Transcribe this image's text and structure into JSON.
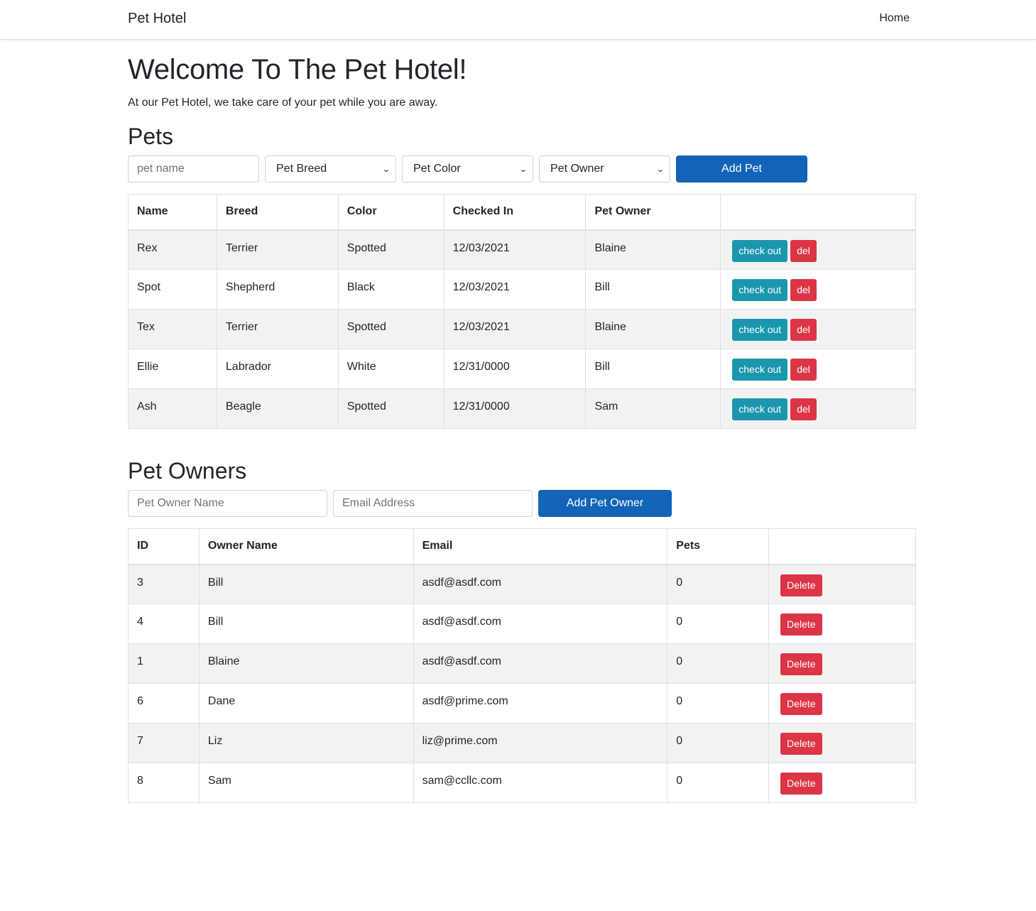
{
  "navbar": {
    "brand": "Pet Hotel",
    "home_link": "Home"
  },
  "header": {
    "title": "Welcome To The Pet Hotel!",
    "subtitle": "At our Pet Hotel, we take care of your pet while you are away."
  },
  "pets": {
    "heading": "Pets",
    "form": {
      "name_placeholder": "pet name",
      "breed_select": "Pet Breed",
      "color_select": "Pet Color",
      "owner_select": "Pet Owner",
      "add_button": "Add Pet"
    },
    "columns": [
      "Name",
      "Breed",
      "Color",
      "Checked In",
      "Pet Owner",
      ""
    ],
    "rows": [
      {
        "name": "Rex",
        "breed": "Terrier",
        "color": "Spotted",
        "checked_in": "12/03/2021",
        "owner": "Blaine"
      },
      {
        "name": "Spot",
        "breed": "Shepherd",
        "color": "Black",
        "checked_in": "12/03/2021",
        "owner": "Bill"
      },
      {
        "name": "Tex",
        "breed": "Terrier",
        "color": "Spotted",
        "checked_in": "12/03/2021",
        "owner": "Blaine"
      },
      {
        "name": "Ellie",
        "breed": "Labrador",
        "color": "White",
        "checked_in": "12/31/0000",
        "owner": "Bill"
      },
      {
        "name": "Ash",
        "breed": "Beagle",
        "color": "Spotted",
        "checked_in": "12/31/0000",
        "owner": "Sam"
      }
    ],
    "checkout_label": "check out",
    "delete_label": "del"
  },
  "owners": {
    "heading": "Pet Owners",
    "form": {
      "name_placeholder": "Pet Owner Name",
      "email_placeholder": "Email Address",
      "add_button": "Add Pet Owner"
    },
    "columns": [
      "ID",
      "Owner Name",
      "Email",
      "Pets",
      ""
    ],
    "rows": [
      {
        "id": "3",
        "name": "Bill",
        "email": "asdf@asdf.com",
        "pets": "0"
      },
      {
        "id": "4",
        "name": "Bill",
        "email": "asdf@asdf.com",
        "pets": "0"
      },
      {
        "id": "1",
        "name": "Blaine",
        "email": "asdf@asdf.com",
        "pets": "0"
      },
      {
        "id": "6",
        "name": "Dane",
        "email": "asdf@prime.com",
        "pets": "0"
      },
      {
        "id": "7",
        "name": "Liz",
        "email": "liz@prime.com",
        "pets": "0"
      },
      {
        "id": "8",
        "name": "Sam",
        "email": "sam@ccllc.com",
        "pets": "0"
      }
    ],
    "delete_label": "Delete"
  },
  "colors": {
    "primary": "#1164b8",
    "info": "#1a97ad",
    "danger": "#dc3545",
    "striped_row": "#f2f2f2"
  }
}
